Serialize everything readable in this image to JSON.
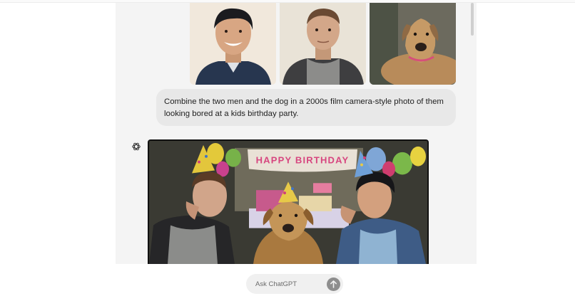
{
  "conversation": {
    "user_message": "Combine the two men and the dog in a 2000s film camera-style photo of them looking bored at a kids birthday party.",
    "uploaded_images": [
      {
        "subject": "man-smiling"
      },
      {
        "subject": "man-grey-shirt"
      },
      {
        "subject": "dog"
      }
    ],
    "assistant": {
      "icon": "chatgpt-logo-icon",
      "generated_image": {
        "banner_text": "HAPPY BIRTHDAY"
      }
    }
  },
  "composer": {
    "placeholder": "Ask ChatGPT",
    "send_icon": "arrow-up-icon"
  },
  "colors": {
    "panel_bg": "#f4f4f4",
    "bubble_bg": "#e8e8e8",
    "send_button": "#8e8e8e"
  }
}
